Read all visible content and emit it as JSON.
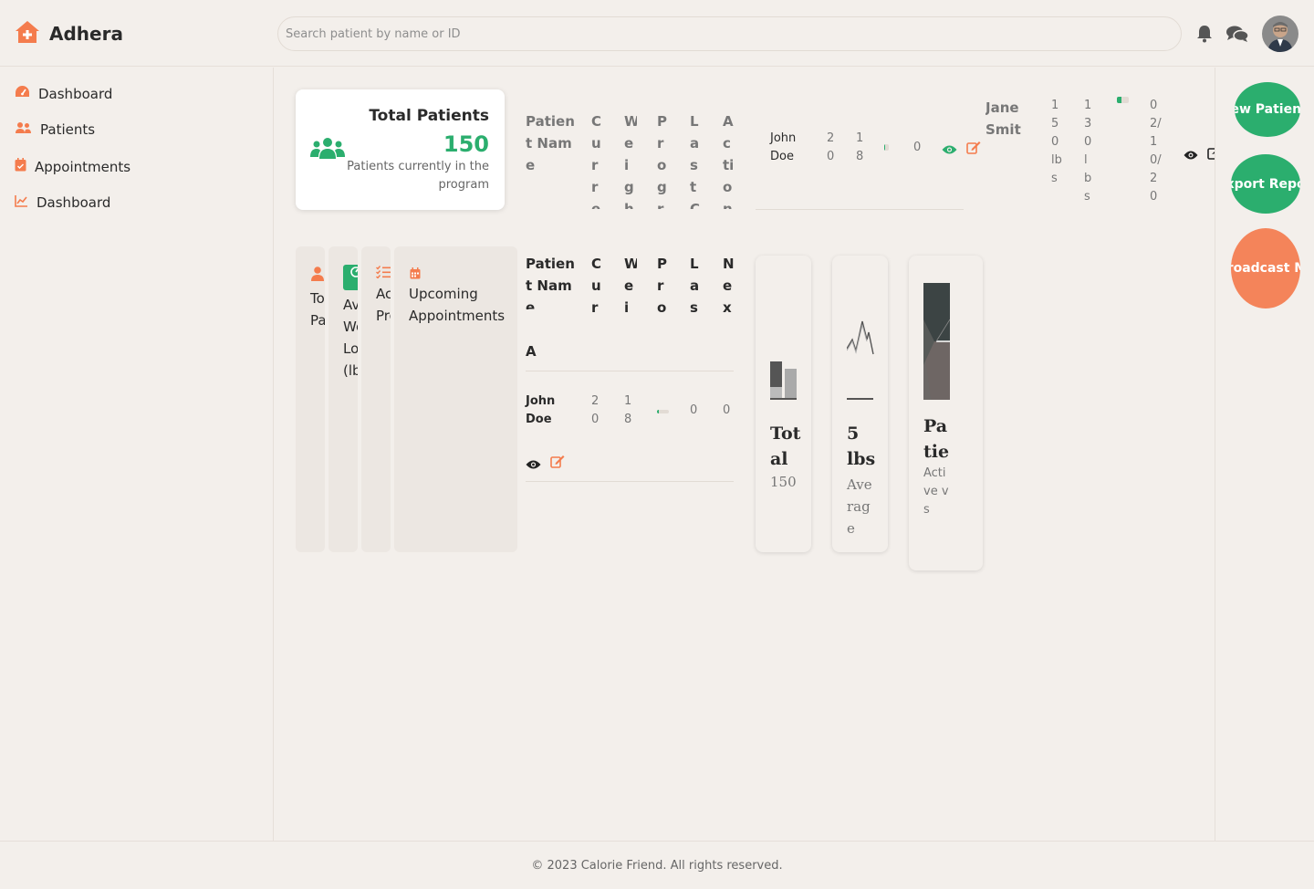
{
  "brand": {
    "name": "Adhera"
  },
  "search": {
    "placeholder": "Search patient by name or ID"
  },
  "sidebar": {
    "items": [
      {
        "label": "Dashboard",
        "icon": "gauge-icon"
      },
      {
        "label": "Patients",
        "icon": "users-icon"
      },
      {
        "label": "Appointments",
        "icon": "calendar-icon"
      },
      {
        "label": "Dashboard",
        "icon": "chart-line-icon"
      }
    ]
  },
  "total_card": {
    "title": "Total Patients",
    "value": "150",
    "subtitle": "Patients currently in the program"
  },
  "table1": {
    "headers": [
      "Patient Name",
      "Current",
      "Weight",
      "Progress",
      "Last Check",
      "Action"
    ],
    "row": {
      "name": "John Doe",
      "c1": "20",
      "c2": "18",
      "progress": 0.1,
      "last": "0"
    }
  },
  "jane_row": {
    "name": "Jane Smith",
    "start": "150 lbs",
    "current": "130 lbs",
    "progress": 0.4,
    "date": "02/10/20"
  },
  "mini_cards": [
    {
      "label": "Total Patients"
    },
    {
      "label": "Average Weight Loss (lbs)"
    },
    {
      "label": "Active Programs"
    },
    {
      "label": "Upcoming Appointments"
    }
  ],
  "table2": {
    "headers": [
      "Patient Name",
      "Current",
      "Weight",
      "Progress",
      "Last",
      "Next"
    ],
    "section": "A",
    "row": {
      "name": "John Doe",
      "c1": "20",
      "c2": "18",
      "progress": 0.15,
      "last": "0",
      "next": "0"
    }
  },
  "chart_cards": [
    {
      "title": "Total",
      "value": "150"
    },
    {
      "title": "5 lbs",
      "value": "Average"
    },
    {
      "title": "Patie",
      "value": "Active vs"
    }
  ],
  "actions": [
    "Add New Patient",
    "Export Report",
    "Broadcast Message"
  ],
  "footer": {
    "text": "© 2023 Calorie Friend. All rights reserved."
  },
  "colors": {
    "accent": "#f47c4d",
    "success": "#2bae6e",
    "background": "#f3efeb"
  }
}
